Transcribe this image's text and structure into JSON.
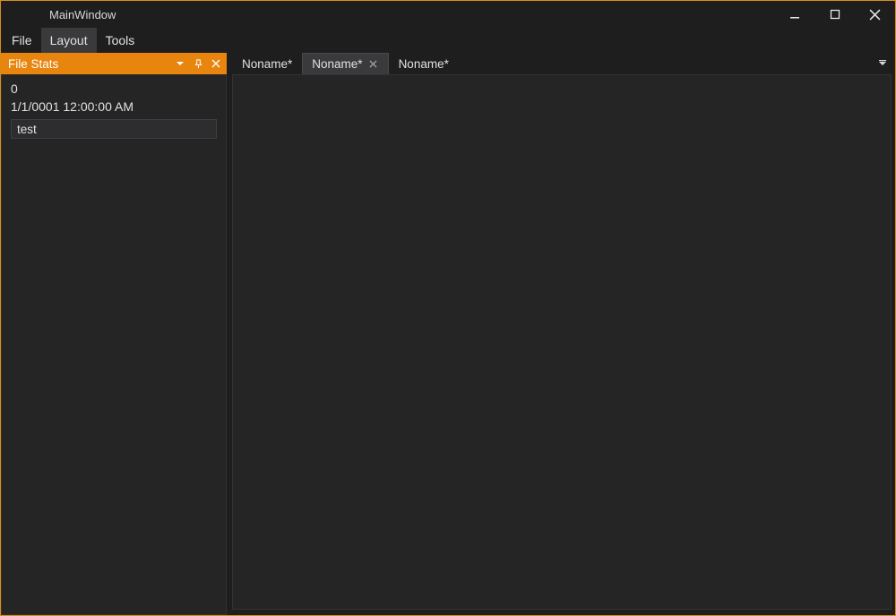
{
  "window": {
    "title": "MainWindow"
  },
  "menu": {
    "items": [
      "File",
      "Layout",
      "Tools"
    ],
    "hover_index": 1
  },
  "side_panel": {
    "title": "File Stats",
    "stats": {
      "count": "0",
      "timestamp": "1/1/0001 12:00:00 AM"
    },
    "input_value": "test"
  },
  "tabs": {
    "items": [
      {
        "label": "Noname*",
        "active": false
      },
      {
        "label": "Noname*",
        "active": true
      },
      {
        "label": "Noname*",
        "active": false
      }
    ]
  },
  "colors": {
    "accent": "#e8850e"
  }
}
